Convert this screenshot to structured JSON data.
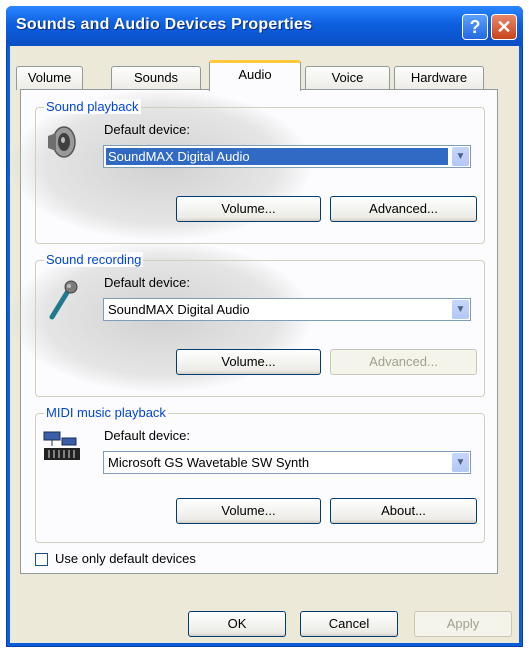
{
  "window": {
    "title": "Sounds and Audio Devices Properties",
    "help_glyph": "?",
    "close_glyph": "✕"
  },
  "tabs": [
    {
      "label": "Volume"
    },
    {
      "label": "Sounds"
    },
    {
      "label": "Audio"
    },
    {
      "label": "Voice"
    },
    {
      "label": "Hardware"
    }
  ],
  "playback": {
    "group_label": "Sound playback",
    "default_label": "Default device:",
    "device": "SoundMAX Digital Audio",
    "volume_label": "Volume...",
    "advanced_label": "Advanced..."
  },
  "recording": {
    "group_label": "Sound recording",
    "default_label": "Default device:",
    "device": "SoundMAX Digital Audio",
    "volume_label": "Volume...",
    "advanced_label": "Advanced..."
  },
  "midi": {
    "group_label": "MIDI music playback",
    "default_label": "Default device:",
    "device": "Microsoft GS Wavetable SW Synth",
    "volume_label": "Volume...",
    "about_label": "About..."
  },
  "options": {
    "default_only_label": "Use only default devices"
  },
  "footer": {
    "ok_label": "OK",
    "cancel_label": "Cancel",
    "apply_label": "Apply"
  },
  "icons": {
    "dropdown": "chevron-down-icon",
    "speaker": "speaker-icon",
    "microphone": "microphone-icon",
    "midi": "midi-keyboard-icon"
  }
}
